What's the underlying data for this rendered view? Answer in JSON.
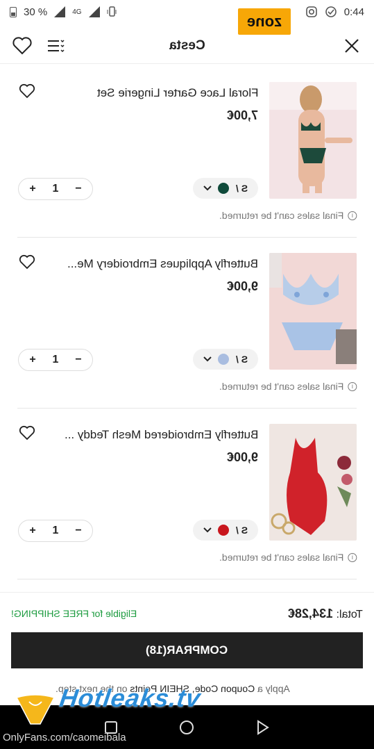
{
  "status_bar": {
    "time": "0:44",
    "battery": "30 %",
    "network": "4G"
  },
  "brand_badge": "zone",
  "header": {
    "title": "Cesta",
    "icons": [
      "close-icon",
      "filter-menu-icon",
      "heart-icon"
    ]
  },
  "items": [
    {
      "name": "Floral Lace Garter Lingerie Set",
      "price": "7,00€",
      "size": "S /",
      "swatch_color": "#0f4a3a",
      "quantity": "1",
      "final_sale": "Final sales can't be returned."
    },
    {
      "name": "Butterfly Appliques Embroidery Me...",
      "price": "9,00€",
      "size": "S /",
      "swatch_color": "#a9bde0",
      "quantity": "1",
      "final_sale": "Final sales can't be returned."
    },
    {
      "name": "Butterfly Embroidered Mesh Teddy ...",
      "price": "9,00€",
      "size": "S /",
      "swatch_color": "#c8161d",
      "quantity": "1",
      "final_sale": "Final sales can't be returned."
    }
  ],
  "footer": {
    "total_label": "Total:",
    "total_value": "134,28€",
    "free_shipping": "Eligible for FREE SHIPPING!",
    "checkout_label": "COMPRAR(18)",
    "coupon_prefix": "Apply a",
    "coupon_bold": "Coupon Code, SHEIN Points",
    "coupon_suffix": "on the next step."
  },
  "watermark": {
    "site": "Hotleaks.tv",
    "account": "OnlyFans.com/caomeibala"
  }
}
